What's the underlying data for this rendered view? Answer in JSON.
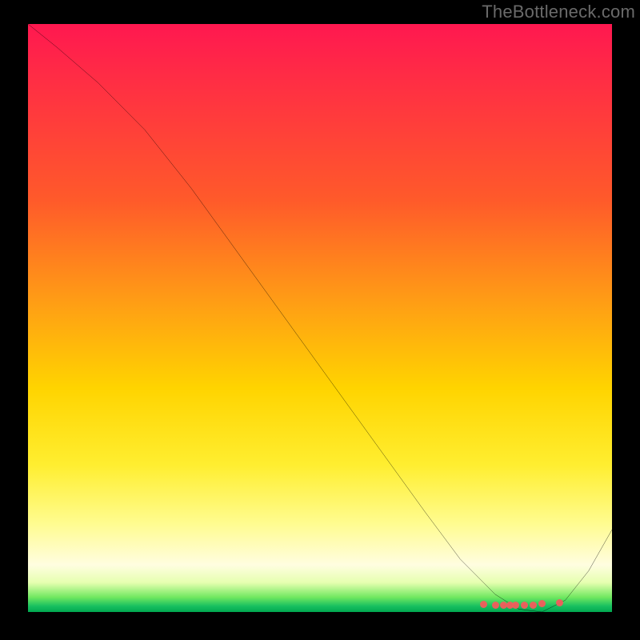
{
  "attribution": "TheBottleneck.com",
  "chart_data": {
    "type": "line",
    "title": "",
    "xlabel": "",
    "ylabel": "",
    "xlim": [
      0,
      100
    ],
    "ylim": [
      0,
      100
    ],
    "grid": false,
    "legend": false,
    "background_gradient": {
      "orientation": "vertical",
      "description": "Diverging heat gradient from red/magenta at top through orange and yellow to a thin green band at the very bottom (lower values of y correspond to cooler / green colors).",
      "stops": [
        {
          "pos": 0.0,
          "color": "#ff1850"
        },
        {
          "pos": 0.3,
          "color": "#ff5a2a"
        },
        {
          "pos": 0.62,
          "color": "#ffd400"
        },
        {
          "pos": 0.85,
          "color": "#fffc90"
        },
        {
          "pos": 0.95,
          "color": "#e6ffb0"
        },
        {
          "pos": 1.0,
          "color": "#00a850"
        }
      ]
    },
    "series": [
      {
        "name": "curve",
        "type": "line",
        "color": "#000000",
        "x": [
          0,
          5,
          12,
          20,
          28,
          36,
          44,
          52,
          60,
          68,
          74,
          80,
          84,
          88,
          92,
          96,
          100
        ],
        "y": [
          100,
          96,
          90,
          82,
          72,
          61,
          50,
          39,
          28,
          17,
          9,
          3,
          0.5,
          0,
          2,
          7,
          14
        ]
      },
      {
        "name": "bottom-cluster",
        "type": "scatter",
        "color": "#f25c5c",
        "x": [
          78,
          80,
          81.5,
          82.5,
          83.5,
          85,
          86.5,
          88,
          91
        ],
        "y": [
          0.5,
          0.4,
          0.4,
          0.4,
          0.4,
          0.4,
          0.4,
          0.6,
          0.7
        ]
      }
    ],
    "notes": "No axis ticks, labels, or legend are visible in the source image; values on both axes are normalized 0–100. The single black curve descends from the upper-left, accelerates after roughly x≈25, reaches a minimum near x≈88 at the very bottom of the plot, and rises again toward the right edge. A short horizontal cluster of small salmon-colored dots sits along the minimum."
  }
}
